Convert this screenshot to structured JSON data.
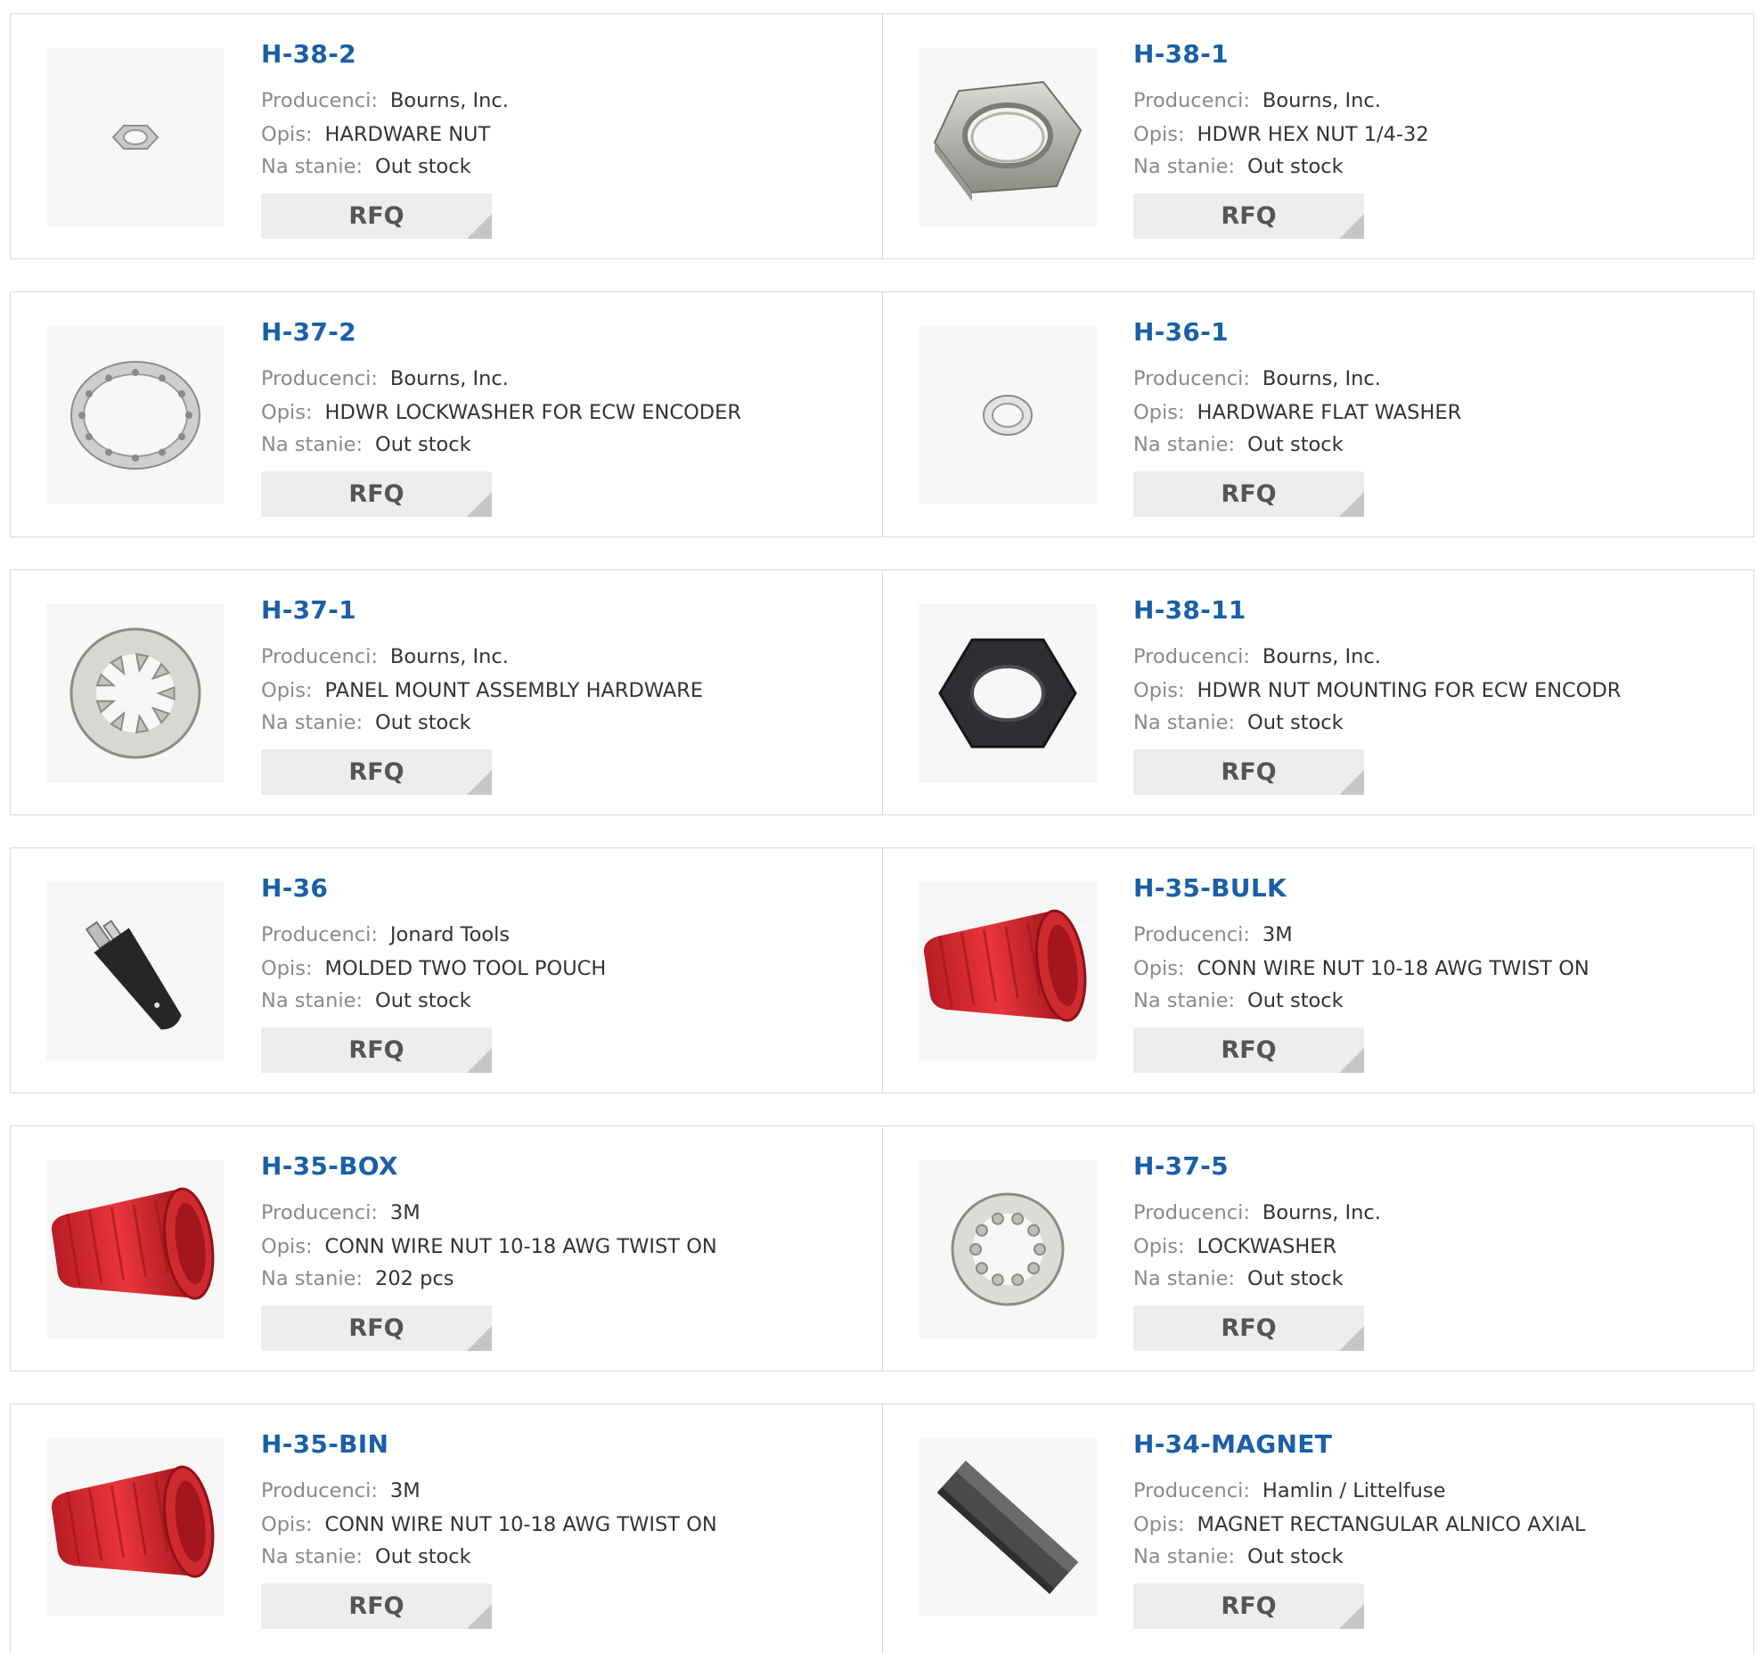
{
  "labels": {
    "manufacturer": "Producenci:",
    "description": "Opis:",
    "stock": "Na stanie:",
    "rfq": "RFQ"
  },
  "products": [
    {
      "part": "H-38-2",
      "manufacturer": "Bourns, Inc.",
      "description": "HARDWARE NUT",
      "stock": "Out stock",
      "image": "small-hex-nut"
    },
    {
      "part": "H-38-1",
      "manufacturer": "Bourns, Inc.",
      "description": "HDWR HEX NUT 1/4-32",
      "stock": "Out stock",
      "image": "hex-nut"
    },
    {
      "part": "H-37-2",
      "manufacturer": "Bourns, Inc.",
      "description": "HDWR LOCKWASHER FOR ECW ENCODER",
      "stock": "Out stock",
      "image": "lockwasher-thin"
    },
    {
      "part": "H-36-1",
      "manufacturer": "Bourns, Inc.",
      "description": "HARDWARE FLAT WASHER",
      "stock": "Out stock",
      "image": "small-washer"
    },
    {
      "part": "H-37-1",
      "manufacturer": "Bourns, Inc.",
      "description": "PANEL MOUNT ASSEMBLY HARDWARE",
      "stock": "Out stock",
      "image": "lockwasher-teeth"
    },
    {
      "part": "H-38-11",
      "manufacturer": "Bourns, Inc.",
      "description": "HDWR NUT MOUNTING FOR ECW ENCODR",
      "stock": "Out stock",
      "image": "black-hex-nut"
    },
    {
      "part": "H-36",
      "manufacturer": "Jonard Tools",
      "description": "MOLDED TWO TOOL POUCH",
      "stock": "Out stock",
      "image": "tool-pouch"
    },
    {
      "part": "H-35-BULK",
      "manufacturer": "3M",
      "description": "CONN WIRE NUT 10-18 AWG TWIST ON",
      "stock": "Out stock",
      "image": "red-wire-nut"
    },
    {
      "part": "H-35-BOX",
      "manufacturer": "3M",
      "description": "CONN WIRE NUT 10-18 AWG TWIST ON",
      "stock": "202 pcs",
      "image": "red-wire-nut"
    },
    {
      "part": "H-37-5",
      "manufacturer": "Bourns, Inc.",
      "description": "LOCKWASHER",
      "stock": "Out stock",
      "image": "lockwasher-teeth-small"
    },
    {
      "part": "H-35-BIN",
      "manufacturer": "3M",
      "description": "CONN WIRE NUT 10-18 AWG TWIST ON",
      "stock": "Out stock",
      "image": "red-wire-nut"
    },
    {
      "part": "H-34-MAGNET",
      "manufacturer": "Hamlin / Littelfuse",
      "description": "MAGNET RECTANGULAR ALNICO AXIAL",
      "stock": "Out stock",
      "image": "bar-magnet"
    }
  ],
  "colors": {
    "link": "#1a5fa8",
    "label": "#8a8a8a",
    "value": "#333333",
    "button_bg": "#ededed",
    "border": "#d9d9d9"
  }
}
